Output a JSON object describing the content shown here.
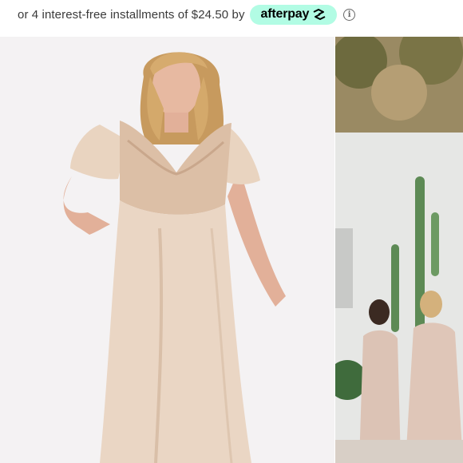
{
  "installments": {
    "text": "or 4 interest-free installments of $24.50 by",
    "provider_label": "afterpay",
    "provider_icon": "afterpay-arrows-icon",
    "info_icon": "info-icon",
    "info_glyph": "i",
    "badge_color": "#b2fce4"
  },
  "gallery": {
    "main_image": "model-in-champagne-satin-maxi-dress",
    "side_image": "bridesmaids-in-champagne-dresses-outdoors"
  },
  "colors": {
    "dress": "#e8d3bf",
    "background": "#f4f2f3"
  }
}
